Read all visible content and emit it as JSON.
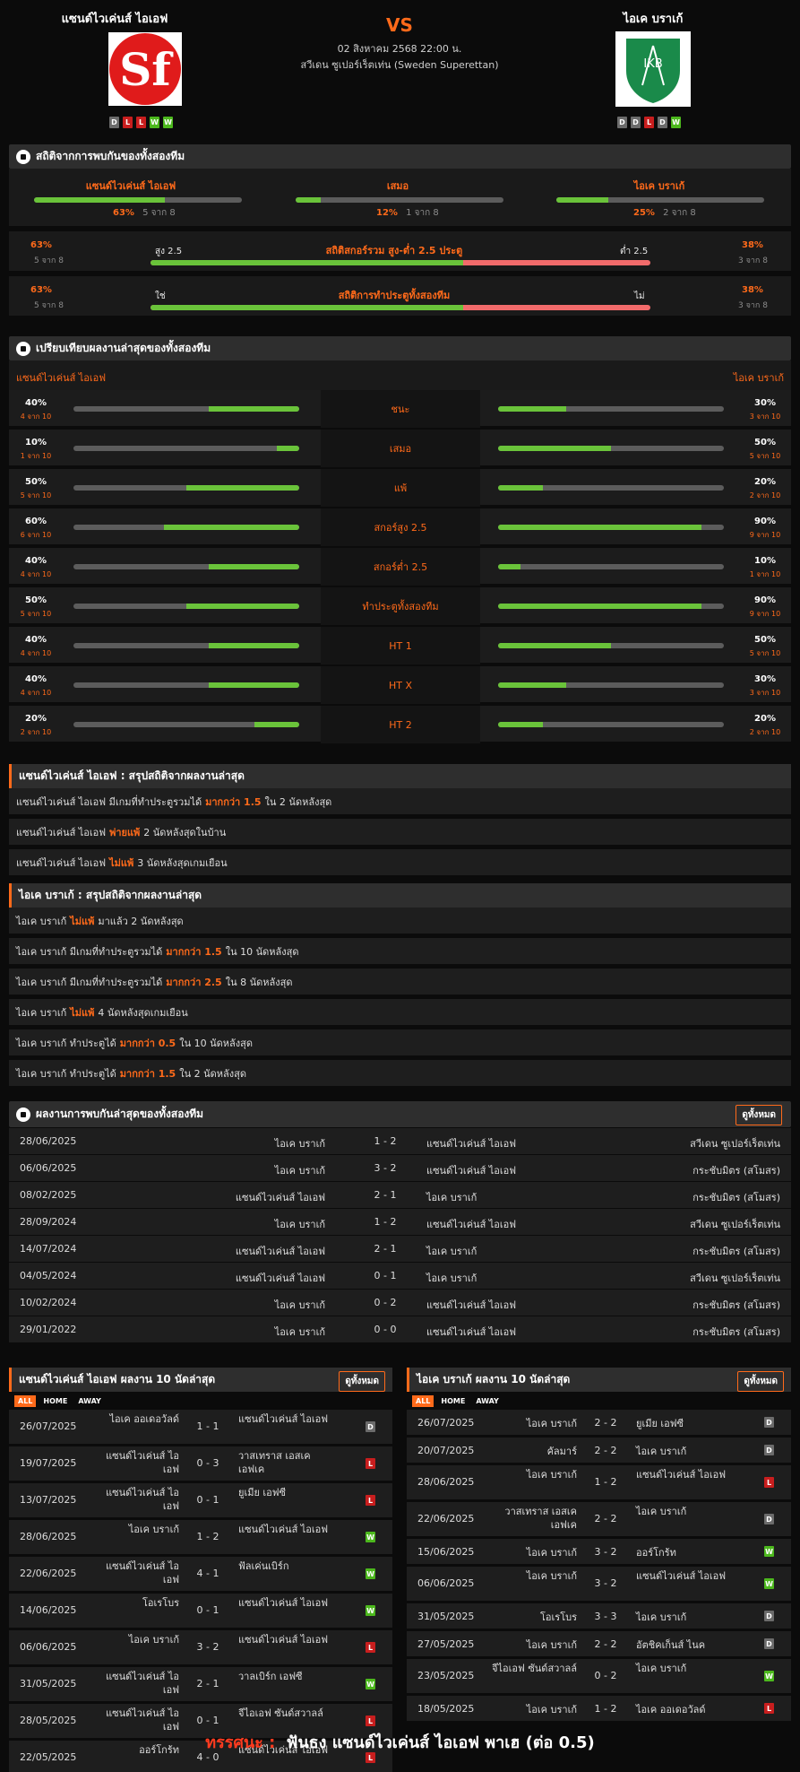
{
  "match": {
    "home_name": "แซนด์ไวเค่นส์ ไอเอฟ",
    "away_name": "ไอเค บราเก้",
    "vs": "VS",
    "date": "02 สิงหาคม 2568 22:00 น.",
    "league": "สวีเดน ซูเปอร์เร็ตเท่น (Sweden Superettan)",
    "home_logo_text": "Sf",
    "away_logo_text": "IKB",
    "home_form": [
      "D",
      "L",
      "L",
      "W",
      "W"
    ],
    "away_form": [
      "D",
      "D",
      "L",
      "D",
      "W"
    ]
  },
  "h2h_stats": {
    "title": "สถิติจากการพบกันของทั้งสองทีม",
    "cols": [
      {
        "label": "แซนด์ไวเค่นส์ ไอเอฟ",
        "pct": "63%",
        "sub": "5 จาก 8",
        "fill": 0.63
      },
      {
        "label": "เสมอ",
        "pct": "12%",
        "sub": "1 จาก 8",
        "fill": 0.12
      },
      {
        "label": "ไอเค บราเก้",
        "pct": "25%",
        "sub": "2 จาก 8",
        "fill": 0.25
      }
    ],
    "ou": {
      "title": "สถิติสกอร์รวม สูง-ต่ำ 2.5 ประตู",
      "left_pct": "63%",
      "left_sub": "5 จาก 8",
      "left_label": "สูง 2.5",
      "right_label": "ต่ำ 2.5",
      "right_pct": "38%",
      "right_sub": "3 จาก 8",
      "fill": 0.625
    },
    "btts": {
      "title": "สถิติการทำประตูทั้งสองทีม",
      "left_pct": "63%",
      "left_sub": "5 จาก 8",
      "left_label": "ใช่",
      "right_label": "ไม่",
      "right_pct": "38%",
      "right_sub": "3 จาก 8",
      "fill": 0.625
    }
  },
  "compare": {
    "title": "เปรียบเทียบผลงานล่าสุดของทั้งสองทีม",
    "home_label": "แซนด์ไวเค่นส์ ไอเอฟ",
    "away_label": "ไอเค บราเก้",
    "rows": [
      {
        "label": "ชนะ",
        "hp": "40%",
        "hs": "4 จาก 10",
        "hf": 0.4,
        "ap": "30%",
        "as": "3 จาก 10",
        "af": 0.3
      },
      {
        "label": "เสมอ",
        "hp": "10%",
        "hs": "1 จาก 10",
        "hf": 0.1,
        "ap": "50%",
        "as": "5 จาก 10",
        "af": 0.5
      },
      {
        "label": "แพ้",
        "hp": "50%",
        "hs": "5 จาก 10",
        "hf": 0.5,
        "ap": "20%",
        "as": "2 จาก 10",
        "af": 0.2
      },
      {
        "label": "สกอร์สูง 2.5",
        "hp": "60%",
        "hs": "6 จาก 10",
        "hf": 0.6,
        "ap": "90%",
        "as": "9 จาก 10",
        "af": 0.9
      },
      {
        "label": "สกอร์ต่ำ 2.5",
        "hp": "40%",
        "hs": "4 จาก 10",
        "hf": 0.4,
        "ap": "10%",
        "as": "1 จาก 10",
        "af": 0.1
      },
      {
        "label": "ทำประตูทั้งสองทีม",
        "hp": "50%",
        "hs": "5 จาก 10",
        "hf": 0.5,
        "ap": "90%",
        "as": "9 จาก 10",
        "af": 0.9
      },
      {
        "label": "HT 1",
        "hp": "40%",
        "hs": "4 จาก 10",
        "hf": 0.4,
        "ap": "50%",
        "as": "5 จาก 10",
        "af": 0.5
      },
      {
        "label": "HT X",
        "hp": "40%",
        "hs": "4 จาก 10",
        "hf": 0.4,
        "ap": "30%",
        "as": "3 จาก 10",
        "af": 0.3
      },
      {
        "label": "HT 2",
        "hp": "20%",
        "hs": "2 จาก 10",
        "hf": 0.2,
        "ap": "20%",
        "as": "2 จาก 10",
        "af": 0.2
      }
    ]
  },
  "home_summary": {
    "title": "แซนด์ไวเค่นส์ ไอเอฟ : สรุปสถิติจากผลงานล่าสุด",
    "rows": [
      {
        "a": "แซนด์ไวเค่นส์ ไอเอฟ มีเกมที่ทำประตูรวมได้",
        "b": "มากกว่า 1.5",
        "c": "ใน 2 นัดหลังสุด"
      },
      {
        "a": "แซนด์ไวเค่นส์ ไอเอฟ",
        "b": "พ่ายแพ้",
        "c": "2 นัดหลังสุดในบ้าน"
      },
      {
        "a": "แซนด์ไวเค่นส์ ไอเอฟ",
        "b": "ไม่แพ้",
        "c": "3 นัดหลังสุดเกมเยือน"
      }
    ]
  },
  "away_summary": {
    "title": "ไอเค บราเก้ : สรุปสถิติจากผลงานล่าสุด",
    "rows": [
      {
        "a": "ไอเค บราเก้",
        "b": "ไม่แพ้",
        "c": "มาแล้ว 2 นัดหลังสุด"
      },
      {
        "a": "ไอเค บราเก้ มีเกมที่ทำประตูรวมได้",
        "b": "มากกว่า 1.5",
        "c": "ใน 10 นัดหลังสุด"
      },
      {
        "a": "ไอเค บราเก้ มีเกมที่ทำประตูรวมได้",
        "b": "มากกว่า 2.5",
        "c": "ใน 8 นัดหลังสุด"
      },
      {
        "a": "ไอเค บราเก้",
        "b": "ไม่แพ้",
        "c": "4 นัดหลังสุดเกมเยือน"
      },
      {
        "a": "ไอเค บราเก้ ทำประตูได้",
        "b": "มากกว่า 0.5",
        "c": "ใน 10 นัดหลังสุด"
      },
      {
        "a": "ไอเค บราเก้ ทำประตูได้",
        "b": "มากกว่า 1.5",
        "c": "ใน 2 นัดหลังสุด"
      }
    ]
  },
  "h2h_results": {
    "title": "ผลงานการพบกันล่าสุดของทั้งสองทีม",
    "view_all": "ดูทั้งหมด",
    "rows": [
      {
        "date": "28/06/2025",
        "home": "ไอเค บราเก้",
        "score": "1 - 2",
        "away": "แซนด์ไวเค่นส์ ไอเอฟ",
        "comp": "สวีเดน ซูเปอร์เร็ตเท่น"
      },
      {
        "date": "06/06/2025",
        "home": "ไอเค บราเก้",
        "score": "3 - 2",
        "away": "แซนด์ไวเค่นส์ ไอเอฟ",
        "comp": "กระชับมิตร (สโมสร)"
      },
      {
        "date": "08/02/2025",
        "home": "แซนด์ไวเค่นส์ ไอเอฟ",
        "score": "2 - 1",
        "away": "ไอเค บราเก้",
        "comp": "กระชับมิตร (สโมสร)"
      },
      {
        "date": "28/09/2024",
        "home": "ไอเค บราเก้",
        "score": "1 - 2",
        "away": "แซนด์ไวเค่นส์ ไอเอฟ",
        "comp": "สวีเดน ซูเปอร์เร็ตเท่น"
      },
      {
        "date": "14/07/2024",
        "home": "แซนด์ไวเค่นส์ ไอเอฟ",
        "score": "2 - 1",
        "away": "ไอเค บราเก้",
        "comp": "กระชับมิตร (สโมสร)"
      },
      {
        "date": "04/05/2024",
        "home": "แซนด์ไวเค่นส์ ไอเอฟ",
        "score": "0 - 1",
        "away": "ไอเค บราเก้",
        "comp": "สวีเดน ซูเปอร์เร็ตเท่น"
      },
      {
        "date": "10/02/2024",
        "home": "ไอเค บราเก้",
        "score": "0 - 2",
        "away": "แซนด์ไวเค่นส์ ไอเอฟ",
        "comp": "กระชับมิตร (สโมสร)"
      },
      {
        "date": "29/01/2022",
        "home": "ไอเค บราเก้",
        "score": "0 - 0",
        "away": "แซนด์ไวเค่นส์ ไอเอฟ",
        "comp": "กระชับมิตร (สโมสร)"
      }
    ]
  },
  "last10": {
    "view_all": "ดูทั้งหมด",
    "tabs": [
      "ALL",
      "HOME",
      "AWAY"
    ],
    "home": {
      "title": "แซนด์ไวเค่นส์ ไอเอฟ ผลงาน 10 นัดล่าสุด",
      "rows": [
        {
          "date": "26/07/2025",
          "home": "ไอเค ออเดอวัลด์",
          "score": "1 - 1",
          "away": "แซนด์ไวเค่นส์ ไอเอฟ",
          "res": "D"
        },
        {
          "date": "19/07/2025",
          "home": "แซนด์ไวเค่นส์ ไอเอฟ",
          "score": "0 - 3",
          "away": "วาสเทราส เอสเค เอฟเค",
          "res": "L"
        },
        {
          "date": "13/07/2025",
          "home": "แซนด์ไวเค่นส์ ไอเอฟ",
          "score": "0 - 1",
          "away": "ยูเมีย เอฟซี",
          "res": "L"
        },
        {
          "date": "28/06/2025",
          "home": "ไอเค บราเก้",
          "score": "1 - 2",
          "away": "แซนด์ไวเค่นส์ ไอเอฟ",
          "res": "W"
        },
        {
          "date": "22/06/2025",
          "home": "แซนด์ไวเค่นส์ ไอเอฟ",
          "score": "4 - 1",
          "away": "ฟัลเค่นเบิร์ก",
          "res": "W"
        },
        {
          "date": "14/06/2025",
          "home": "โอเรโบร",
          "score": "0 - 1",
          "away": "แซนด์ไวเค่นส์ ไอเอฟ",
          "res": "W"
        },
        {
          "date": "06/06/2025",
          "home": "ไอเค บราเก้",
          "score": "3 - 2",
          "away": "แซนด์ไวเค่นส์ ไอเอฟ",
          "res": "L"
        },
        {
          "date": "31/05/2025",
          "home": "แซนด์ไวเค่นส์ ไอเอฟ",
          "score": "2 - 1",
          "away": "วาลเบิร์ก เอฟซี",
          "res": "W"
        },
        {
          "date": "28/05/2025",
          "home": "แซนด์ไวเค่นส์ ไอเอฟ",
          "score": "0 - 1",
          "away": "จีไอเอฟ ซันด์สวาลล์",
          "res": "L"
        },
        {
          "date": "22/05/2025",
          "home": "ออร์โกร้ท",
          "score": "4 - 0",
          "away": "แซนด์ไวเค่นส์ ไอเอฟ",
          "res": "L"
        }
      ]
    },
    "away": {
      "title": "ไอเค บราเก้ ผลงาน 10 นัดล่าสุด",
      "rows": [
        {
          "date": "26/07/2025",
          "home": "ไอเค บราเก้",
          "score": "2 - 2",
          "away": "ยูเมีย เอฟซี",
          "res": "D"
        },
        {
          "date": "20/07/2025",
          "home": "คัลมาร์",
          "score": "2 - 2",
          "away": "ไอเค บราเก้",
          "res": "D"
        },
        {
          "date": "28/06/2025",
          "home": "ไอเค บราเก้",
          "score": "1 - 2",
          "away": "แซนด์ไวเค่นส์ ไอเอฟ",
          "res": "L"
        },
        {
          "date": "22/06/2025",
          "home": "วาสเทราส เอสเค เอฟเค",
          "score": "2 - 2",
          "away": "ไอเค บราเก้",
          "res": "D"
        },
        {
          "date": "15/06/2025",
          "home": "ไอเค บราเก้",
          "score": "3 - 2",
          "away": "ออร์โกร้ท",
          "res": "W"
        },
        {
          "date": "06/06/2025",
          "home": "ไอเค บราเก้",
          "score": "3 - 2",
          "away": "แซนด์ไวเค่นส์ ไอเอฟ",
          "res": "W"
        },
        {
          "date": "31/05/2025",
          "home": "โอเรโบร",
          "score": "3 - 3",
          "away": "ไอเค บราเก้",
          "res": "D"
        },
        {
          "date": "27/05/2025",
          "home": "ไอเค บราเก้",
          "score": "2 - 2",
          "away": "อัตชิคเก็นส์ ไนค",
          "res": "D"
        },
        {
          "date": "23/05/2025",
          "home": "จีไอเอฟ ซันด์สวาลล์",
          "score": "0 - 2",
          "away": "ไอเค บราเก้",
          "res": "W"
        },
        {
          "date": "18/05/2025",
          "home": "ไอเค บราเก้",
          "score": "1 - 2",
          "away": "ไอเค ออเดอวัลด์",
          "res": "L"
        }
      ]
    }
  },
  "verdict": {
    "label": "ทรรศนะ :",
    "text": "ฟันธง แซนด์ไวเค่นส์ ไอเอฟ พาเฮ (ต่อ 0.5)"
  },
  "colors": {
    "accent": "#ff6a1a",
    "green": "#6ac33a",
    "red": "#f26b6b",
    "bg": "#0b0b0b"
  }
}
